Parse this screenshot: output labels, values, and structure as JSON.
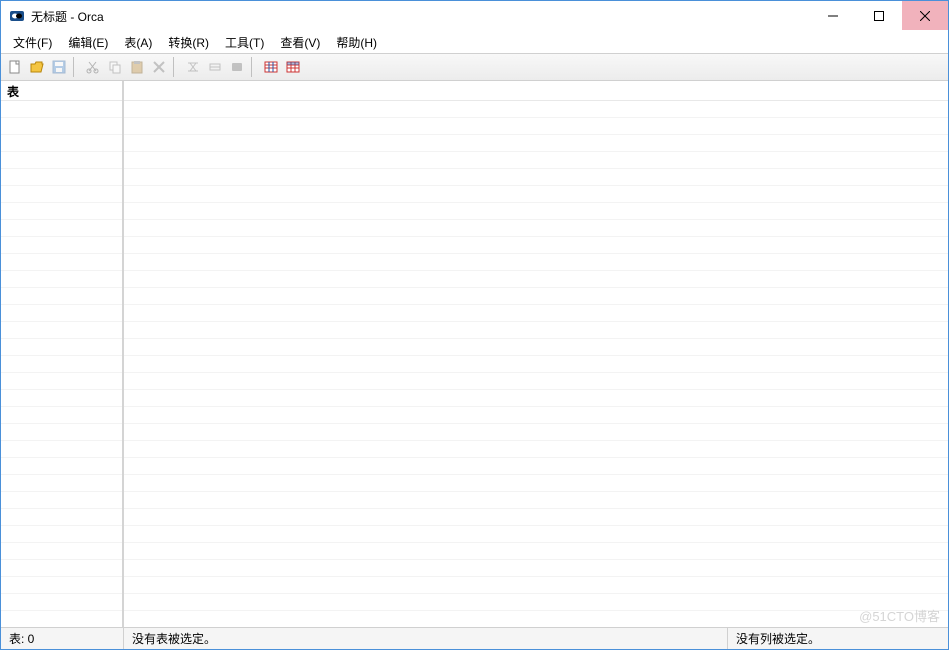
{
  "titlebar": {
    "title": "无标题 - Orca"
  },
  "menu": {
    "file": "文件(F)",
    "edit": "编辑(E)",
    "table": "表(A)",
    "transform": "转换(R)",
    "tools": "工具(T)",
    "view": "查看(V)",
    "help": "帮助(H)"
  },
  "left": {
    "header": "表"
  },
  "status": {
    "tables": "表: 0",
    "no_table": "没有表被选定。",
    "no_column": "没有列被选定。"
  },
  "watermark": "@51CTO博客"
}
